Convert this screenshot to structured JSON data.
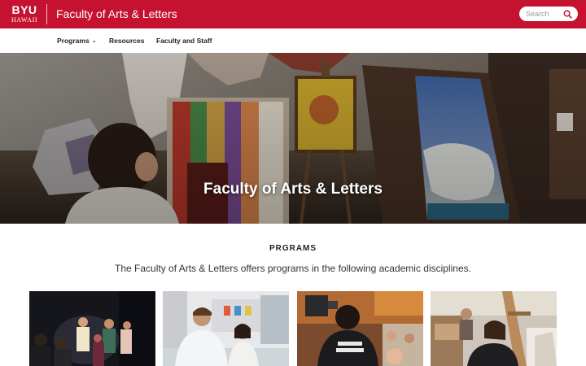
{
  "header": {
    "logo_top": "BYU",
    "logo_bottom": "HAWAII",
    "site_title": "Faculty of Arts & Letters",
    "search_placeholder": "Search",
    "search_icon": "search-icon",
    "brand_color": "#c41230"
  },
  "nav": {
    "items": [
      {
        "label": "Programs",
        "has_dropdown": true
      },
      {
        "label": "Resources",
        "has_dropdown": false
      },
      {
        "label": "Faculty and Staff",
        "has_dropdown": false
      }
    ],
    "dropdown_icon": "chevron-down-icon"
  },
  "hero": {
    "title": "Faculty of Arts & Letters"
  },
  "programs": {
    "heading": "PRGRAMS",
    "intro": "The Faculty of Arts & Letters offers programs in the following academic disciplines.",
    "cards": [
      {
        "image": "theatre-performance-photo"
      },
      {
        "image": "students-at-table-photo"
      },
      {
        "image": "media-crew-camera-photo"
      },
      {
        "image": "art-painting-easel-photo"
      }
    ]
  }
}
